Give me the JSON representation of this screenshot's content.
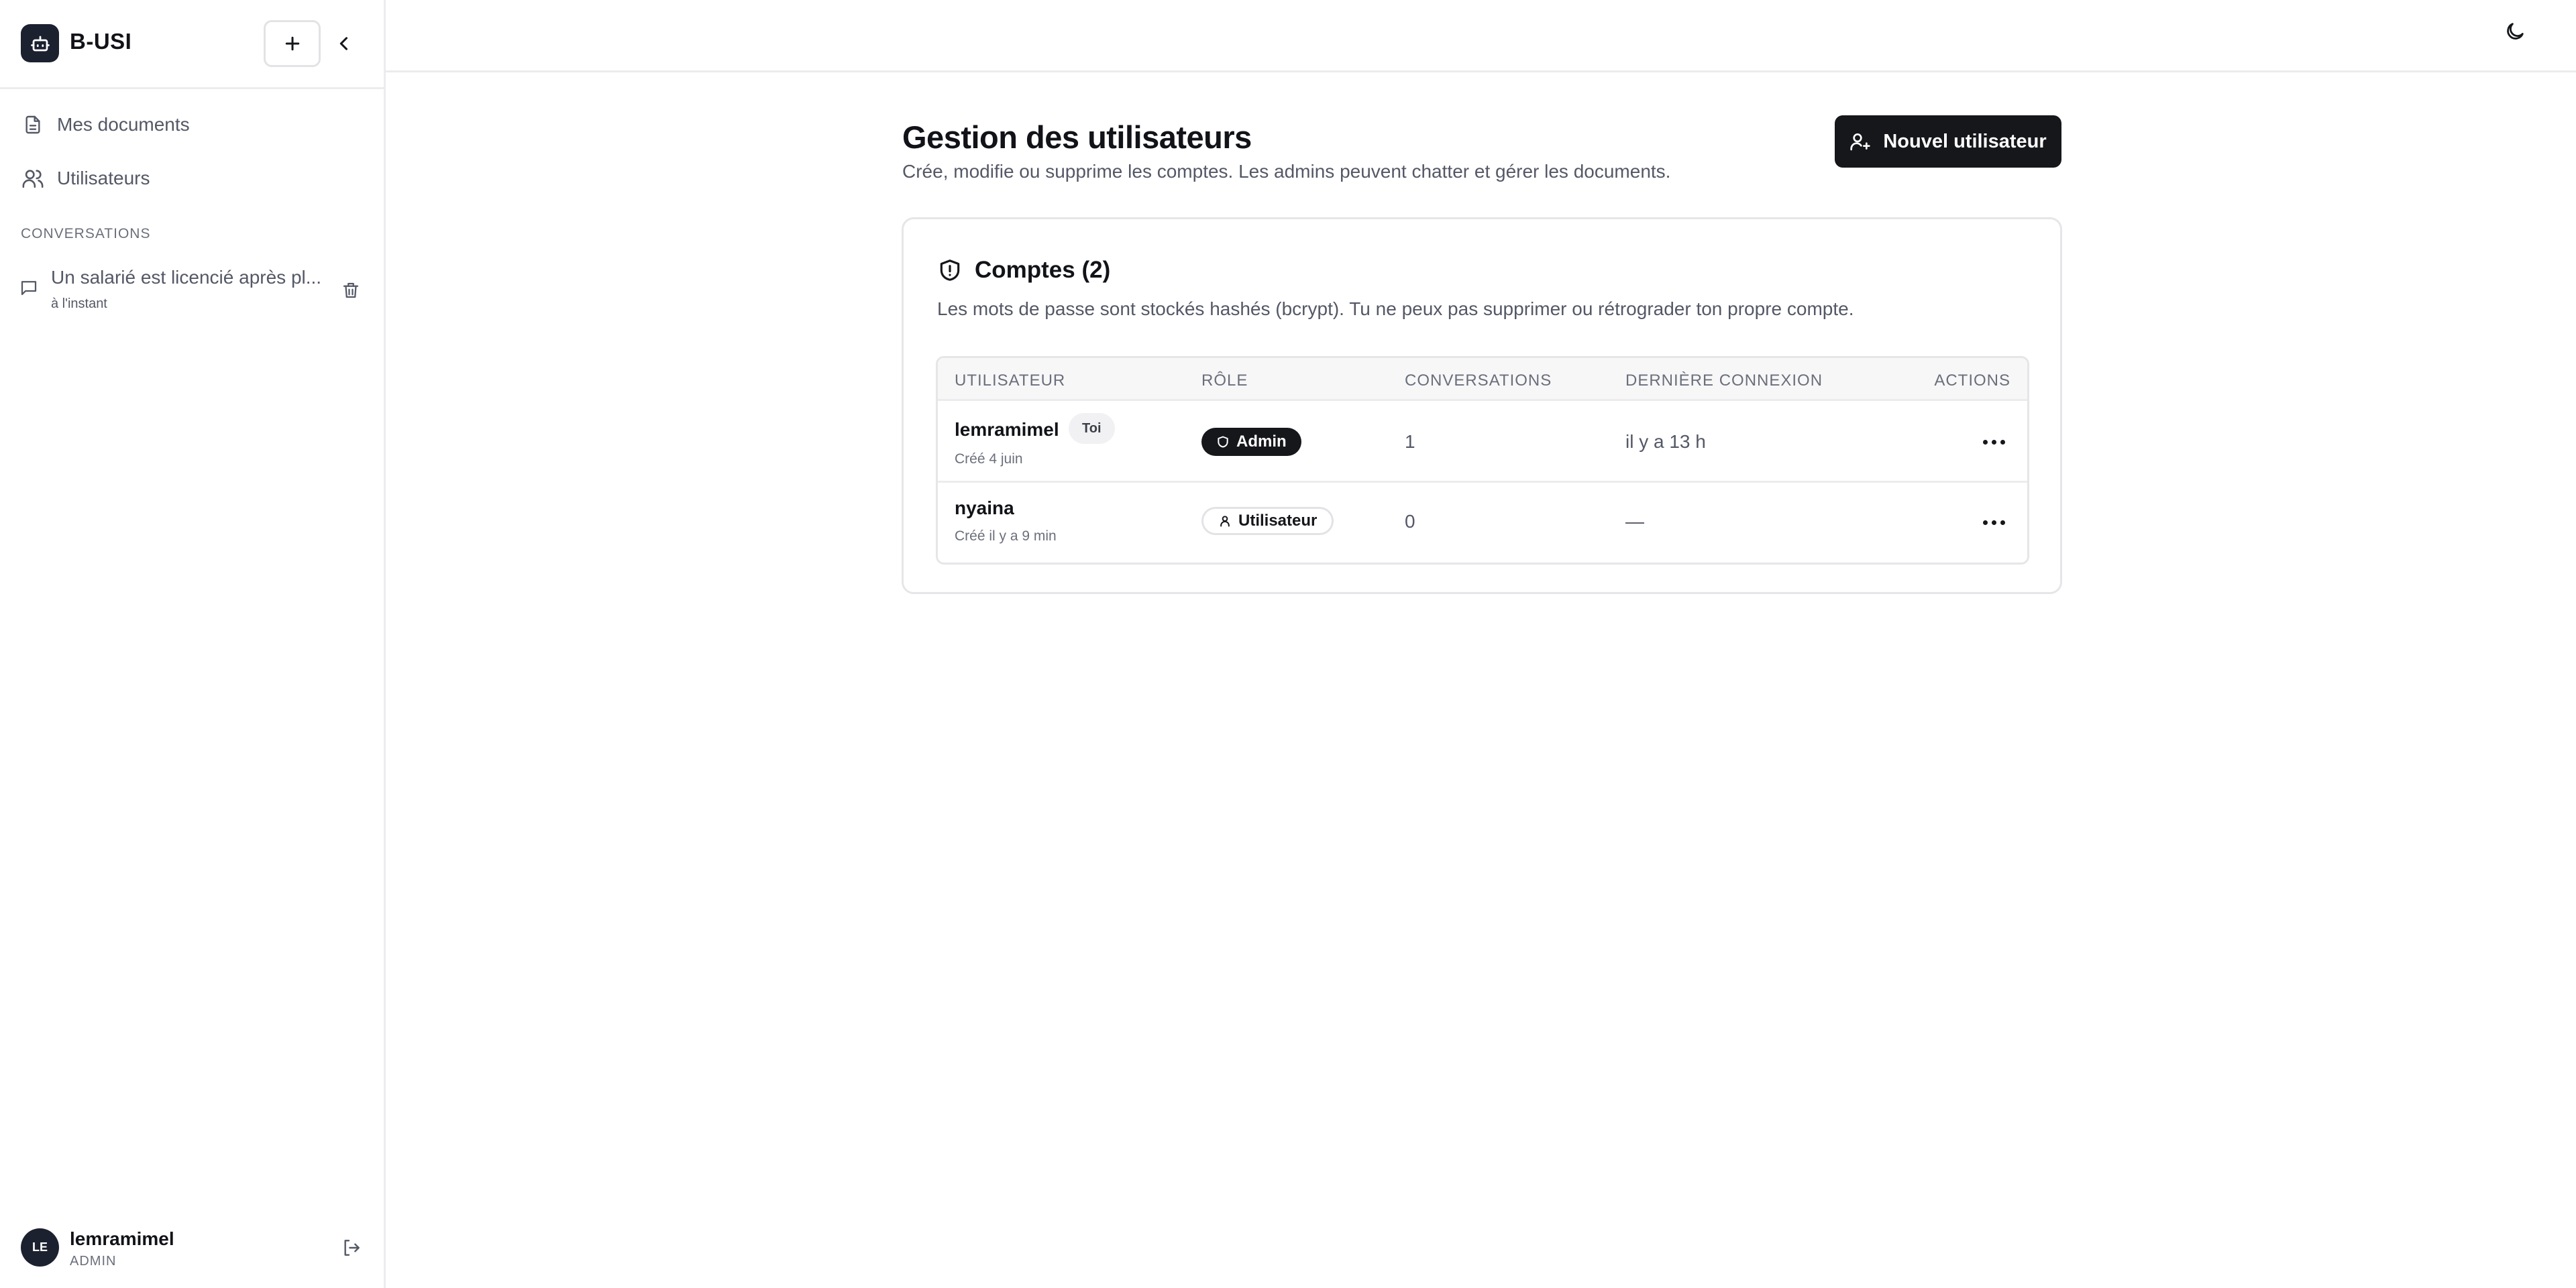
{
  "app": {
    "name": "B-USI"
  },
  "sidebar": {
    "nav": [
      {
        "label": "Mes documents",
        "icon": "file-text-icon"
      },
      {
        "label": "Utilisateurs",
        "icon": "users-icon"
      }
    ],
    "section_label": "CONVERSATIONS",
    "conversations": [
      {
        "title": "Un salarié est licencié après pl...",
        "time": "à l'instant"
      }
    ],
    "user": {
      "initials": "LE",
      "name": "lemramimel",
      "role": "ADMIN"
    }
  },
  "header": {
    "title": "Gestion des utilisateurs",
    "subtitle": "Crée, modifie ou supprime les comptes. Les admins peuvent chatter et gérer les documents.",
    "new_user_label": "Nouvel utilisateur"
  },
  "card": {
    "title": "Comptes (2)",
    "description": "Les mots de passe sont stockés hashés (bcrypt). Tu ne peux pas supprimer ou rétrograder ton propre compte."
  },
  "table": {
    "columns": [
      "UTILISATEUR",
      "RÔLE",
      "CONVERSATIONS",
      "DERNIÈRE CONNEXION",
      "ACTIONS"
    ],
    "rows": [
      {
        "name": "lemramimel",
        "tag": "Toi",
        "created": "Créé 4 juin",
        "role": "Admin",
        "conversations": "1",
        "last_login": "il y a 13 h"
      },
      {
        "name": "nyaina",
        "tag": "",
        "created": "Créé il y a 9 min",
        "role": "Utilisateur",
        "conversations": "0",
        "last_login": "—"
      }
    ]
  },
  "colors": {
    "primary": "#16171b",
    "logo_bg": "#1c2130",
    "border": "#e6e6e9",
    "muted_text": "#545866"
  }
}
